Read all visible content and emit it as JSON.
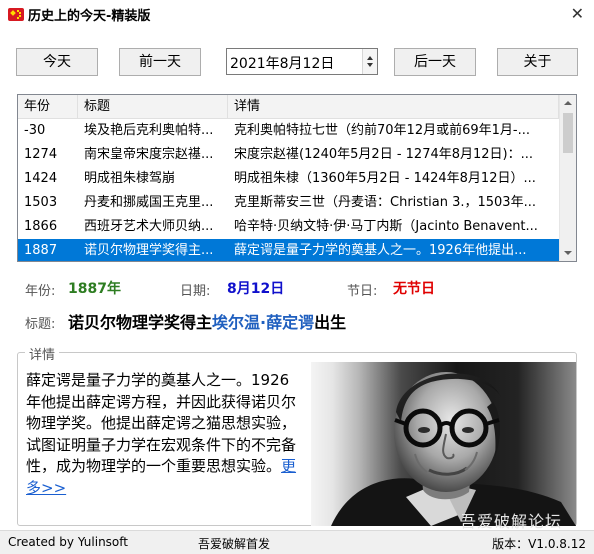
{
  "window": {
    "title": "历史上的今天-精装版",
    "icon": "china-flag-icon",
    "close_glyph": "✕"
  },
  "toolbar": {
    "today_label": "今天",
    "prev_label": "前一天",
    "date_value": "2021年8月12日",
    "next_label": "后一天",
    "about_label": "关于"
  },
  "table": {
    "columns": [
      "年份",
      "标题",
      "详情"
    ],
    "rows": [
      {
        "year": "-30",
        "title": "埃及艳后克利奥帕特...",
        "detail": "克利奥帕特拉七世（约前70年12月或前69年1月-..."
      },
      {
        "year": "1274",
        "title": "南宋皇帝宋度宗赵禥...",
        "detail": "宋度宗赵禥(1240年5月2日 - 1274年8月12日)：..."
      },
      {
        "year": "1424",
        "title": "明成祖朱棣驾崩",
        "detail": "明成祖朱棣（1360年5月2日 - 1424年8月12日）..."
      },
      {
        "year": "1503",
        "title": "丹麦和挪威国王克里...",
        "detail": "克里斯蒂安三世（丹麦语：Christian 3.，1503年..."
      },
      {
        "year": "1866",
        "title": "西班牙艺术大师贝纳...",
        "detail": "哈辛特·贝纳文特·伊·马丁内斯（Jacinto Benavent..."
      },
      {
        "year": "1887",
        "title": "诺贝尔物理学奖得主...",
        "detail": "薛定谔是量子力学的奠基人之一。1926年他提出..."
      }
    ],
    "selected_index": 5
  },
  "info": {
    "year_label": "年份:",
    "year_value": "1887年",
    "date_label": "日期:",
    "date_value": "8月12日",
    "festival_label": "节日:",
    "festival_value": "无节日",
    "title_label": "标题:",
    "headline_prefix": "诺贝尔物理学奖得主",
    "headline_name": "埃尔温·薛定谔",
    "headline_suffix": "出生"
  },
  "details": {
    "group_title": "详情",
    "text": "薛定谔是量子力学的奠基人之一。1926年他提出薛定谔方程，并因此获得诺贝尔物理学奖。他提出薛定谔之猫思想实验，试图证明量子力学在宏观条件下的不完备性，成为物理学的一个重要思想实验。",
    "more_label": "更多>>"
  },
  "watermark": "吾爱破解论坛",
  "statusbar": {
    "left": "Created by Yulinsoft",
    "middle": "吾爱破解首发",
    "right": "版本：V1.0.8.12"
  },
  "colors": {
    "selected_row": "#0078d7",
    "year_value": "#2e7d22",
    "date_value": "#1010cc",
    "festival_value": "#e00000",
    "headline_name": "#1f5fbf",
    "link": "#1a5fd0"
  }
}
